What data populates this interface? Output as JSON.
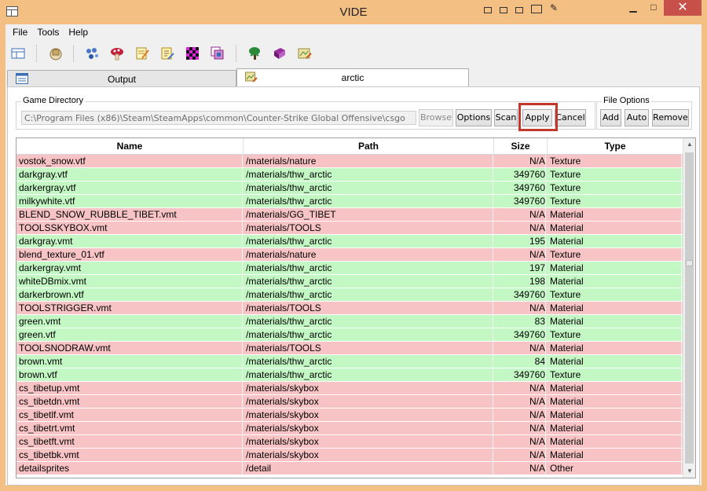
{
  "window": {
    "title": "VIDE"
  },
  "menu": [
    "File",
    "Tools",
    "Help"
  ],
  "toolbar_icons": [
    "grid-view-icon",
    "package-icon",
    "molecules-icon",
    "mushroom-icon",
    "notepad-icon",
    "edit-page-icon",
    "checker-texture-icon",
    "layers-icon",
    "tree-icon",
    "book-icon",
    "map-editor-icon"
  ],
  "tabs": [
    {
      "label": "Output",
      "icon": "output-window-icon",
      "active": false
    },
    {
      "label": "arctic",
      "icon": "map-editor-icon",
      "active": true
    }
  ],
  "game_directory": {
    "title": "Game Directory",
    "path": "C:\\Program Files (x86)\\Steam\\SteamApps\\common\\Counter-Strike Global Offensive\\csgo",
    "buttons": {
      "browse": "Browse",
      "options": "Options",
      "scan": "Scan",
      "apply": "Apply",
      "cancel": "Cancel"
    }
  },
  "file_options": {
    "title": "File Options",
    "buttons": {
      "add": "Add",
      "auto": "Auto",
      "remove": "Remove"
    }
  },
  "colors": {
    "found_row": "#c3f7c3",
    "missing_row": "#f8c3c5",
    "highlight": "#c0392b"
  },
  "table": {
    "columns": [
      "Name",
      "Path",
      "Size",
      "Type"
    ],
    "rows": [
      {
        "name": "vostok_snow.vtf",
        "path": "/materials/nature",
        "size": "N/A",
        "type": "Texture",
        "status": "red"
      },
      {
        "name": "darkgray.vtf",
        "path": "/materials/thw_arctic",
        "size": "349760",
        "type": "Texture",
        "status": "green"
      },
      {
        "name": "darkergray.vtf",
        "path": "/materials/thw_arctic",
        "size": "349760",
        "type": "Texture",
        "status": "green"
      },
      {
        "name": "milkywhite.vtf",
        "path": "/materials/thw_arctic",
        "size": "349760",
        "type": "Texture",
        "status": "green"
      },
      {
        "name": "BLEND_SNOW_RUBBLE_TIBET.vmt",
        "path": "/materials/GG_TIBET",
        "size": "N/A",
        "type": "Material",
        "status": "red"
      },
      {
        "name": "TOOLSSKYBOX.vmt",
        "path": "/materials/TOOLS",
        "size": "N/A",
        "type": "Material",
        "status": "red"
      },
      {
        "name": "darkgray.vmt",
        "path": "/materials/thw_arctic",
        "size": "195",
        "type": "Material",
        "status": "green"
      },
      {
        "name": "blend_texture_01.vtf",
        "path": "/materials/nature",
        "size": "N/A",
        "type": "Texture",
        "status": "red"
      },
      {
        "name": "darkergray.vmt",
        "path": "/materials/thw_arctic",
        "size": "197",
        "type": "Material",
        "status": "green"
      },
      {
        "name": "whiteDBmix.vmt",
        "path": "/materials/thw_arctic",
        "size": "198",
        "type": "Material",
        "status": "green"
      },
      {
        "name": "darkerbrown.vtf",
        "path": "/materials/thw_arctic",
        "size": "349760",
        "type": "Texture",
        "status": "green"
      },
      {
        "name": "TOOLSTRIGGER.vmt",
        "path": "/materials/TOOLS",
        "size": "N/A",
        "type": "Material",
        "status": "red"
      },
      {
        "name": "green.vmt",
        "path": "/materials/thw_arctic",
        "size": "83",
        "type": "Material",
        "status": "green"
      },
      {
        "name": "green.vtf",
        "path": "/materials/thw_arctic",
        "size": "349760",
        "type": "Texture",
        "status": "green"
      },
      {
        "name": "TOOLSNODRAW.vmt",
        "path": "/materials/TOOLS",
        "size": "N/A",
        "type": "Material",
        "status": "red"
      },
      {
        "name": "brown.vmt",
        "path": "/materials/thw_arctic",
        "size": "84",
        "type": "Material",
        "status": "green"
      },
      {
        "name": "brown.vtf",
        "path": "/materials/thw_arctic",
        "size": "349760",
        "type": "Texture",
        "status": "green"
      },
      {
        "name": "cs_tibetup.vmt",
        "path": "/materials/skybox",
        "size": "N/A",
        "type": "Material",
        "status": "red"
      },
      {
        "name": "cs_tibetdn.vmt",
        "path": "/materials/skybox",
        "size": "N/A",
        "type": "Material",
        "status": "red"
      },
      {
        "name": "cs_tibetlf.vmt",
        "path": "/materials/skybox",
        "size": "N/A",
        "type": "Material",
        "status": "red"
      },
      {
        "name": "cs_tibetrt.vmt",
        "path": "/materials/skybox",
        "size": "N/A",
        "type": "Material",
        "status": "red"
      },
      {
        "name": "cs_tibetft.vmt",
        "path": "/materials/skybox",
        "size": "N/A",
        "type": "Material",
        "status": "red"
      },
      {
        "name": "cs_tibetbk.vmt",
        "path": "/materials/skybox",
        "size": "N/A",
        "type": "Material",
        "status": "red"
      },
      {
        "name": "detailsprites",
        "path": "/detail",
        "size": "N/A",
        "type": "Other",
        "status": "red"
      }
    ]
  }
}
